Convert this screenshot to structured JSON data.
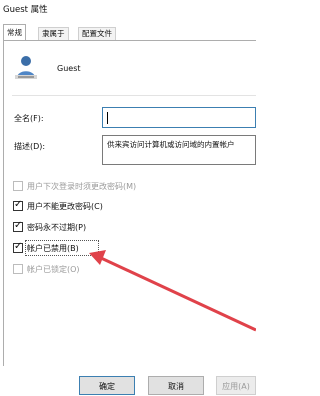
{
  "window": {
    "title": "Guest 属性"
  },
  "tabs": [
    {
      "label": "常规",
      "active": true
    },
    {
      "label": "隶属于",
      "active": false
    },
    {
      "label": "配置文件",
      "active": false
    }
  ],
  "user": {
    "name": "Guest",
    "icon": "user-account-icon"
  },
  "fields": {
    "fullname_label": "全名(F):",
    "fullname_value": "",
    "description_label": "描述(D):",
    "description_value": "供来宾访问计算机或访问域的内置帐户"
  },
  "checkboxes": [
    {
      "label": "用户下次登录时须更改密码(M)",
      "checked": false,
      "enabled": false
    },
    {
      "label": "用户不能更改密码(C)",
      "checked": true,
      "enabled": true
    },
    {
      "label": "密码永不过期(P)",
      "checked": true,
      "enabled": true
    },
    {
      "label": "帐户已禁用(B)",
      "checked": true,
      "enabled": true,
      "focused": true
    },
    {
      "label": "帐户已锁定(O)",
      "checked": false,
      "enabled": false
    }
  ],
  "buttons": {
    "ok": "确定",
    "cancel": "取消",
    "apply": "应用(A)"
  },
  "annotation": {
    "color": "#e0424a"
  }
}
